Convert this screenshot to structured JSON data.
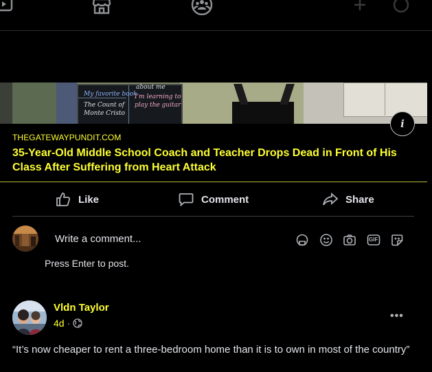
{
  "top_nav": {
    "icons": [
      "video-icon",
      "marketplace-icon",
      "groups-icon",
      "add-icon",
      "messenger-icon"
    ]
  },
  "link_preview": {
    "image_text": [
      "My favorite book",
      "The Count of",
      "Monte Cristo",
      "about me",
      "I'm learning to",
      "play the guitar"
    ],
    "source": "THEGATEWAYPUNDIT.COM",
    "title": "35-Year-Old Middle School Coach and Teacher Drops Dead in Front of His Class After Suffering from Heart Attack",
    "info_label": "i",
    "accent_color": "#ffff33"
  },
  "actions": {
    "like": "Like",
    "comment": "Comment",
    "share": "Share"
  },
  "comment_box": {
    "placeholder": "Write a comment...",
    "hint": "Press Enter to post.",
    "gif_label": "GIF"
  },
  "post": {
    "author": "Vldn Taylor",
    "time": "4d",
    "dot": "·",
    "more": "•••",
    "text": "“It’s now cheaper to rent a three-bedroom home than it is to own in most of the country”"
  }
}
